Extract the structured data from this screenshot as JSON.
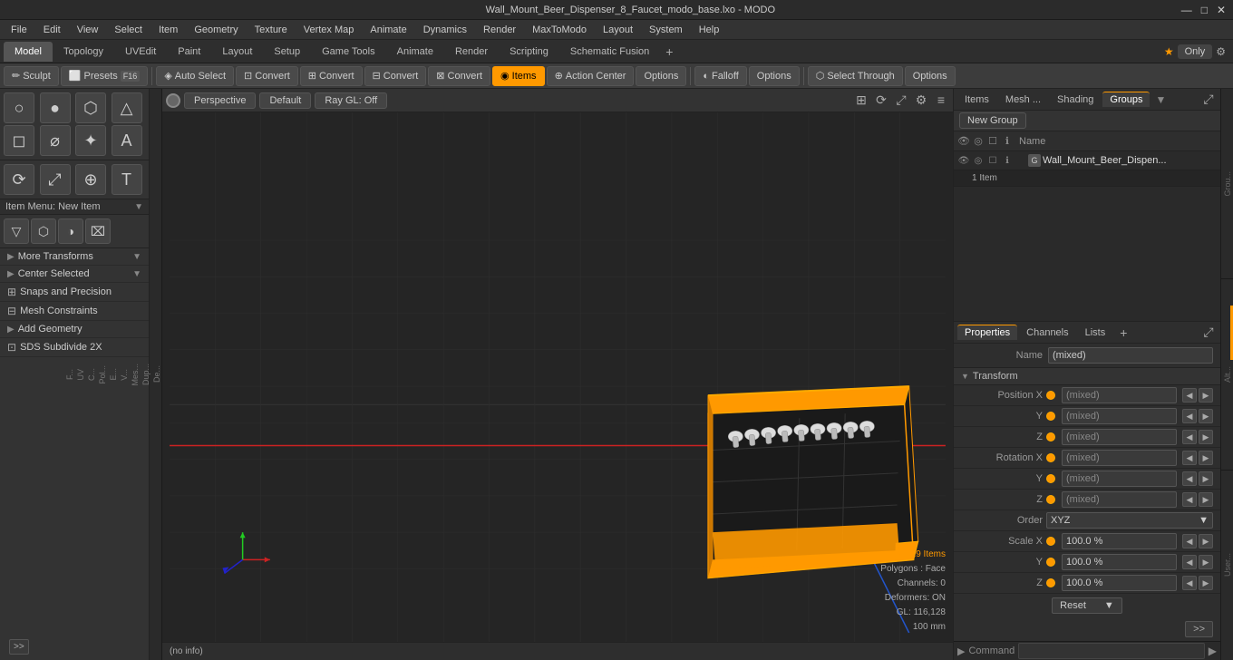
{
  "titleBar": {
    "title": "Wall_Mount_Beer_Dispenser_8_Faucet_modo_base.lxo - MODO",
    "minimize": "—",
    "maximize": "□",
    "close": "✕"
  },
  "menuBar": {
    "items": [
      "File",
      "Edit",
      "View",
      "Select",
      "Item",
      "Geometry",
      "Texture",
      "Vertex Map",
      "Animate",
      "Dynamics",
      "Render",
      "MaxToModo",
      "Layout",
      "System",
      "Help"
    ]
  },
  "tabBar": {
    "tabs": [
      "Model",
      "Topology",
      "UVEdit",
      "Paint",
      "Layout",
      "Setup",
      "Game Tools",
      "Animate",
      "Render",
      "Scripting",
      "Schematic Fusion"
    ],
    "activeTab": "Model",
    "rightLabel": "Only",
    "addLabel": "+"
  },
  "toolbar": {
    "sculpt": "✏ Sculpt",
    "presets": "Presets",
    "presets_key": "F16",
    "autoSelect": "Auto Select",
    "convert1": "Convert",
    "convert2": "Convert",
    "convert3": "Convert",
    "convert4": "Convert",
    "items": "Items",
    "actionCenter": "Action Center",
    "options1": "Options",
    "falloff": "Falloff",
    "options2": "Options",
    "selectThrough": "Select Through",
    "options3": "Options"
  },
  "viewport": {
    "perspective": "Perspective",
    "default": "Default",
    "rayGl": "Ray GL: Off"
  },
  "leftPanel": {
    "tools": [
      "○",
      "●",
      "⬡",
      "△",
      "◻",
      "⌀",
      "✦",
      "A"
    ],
    "tools2": [
      "⟳",
      "⤢",
      "⊕",
      "T"
    ],
    "sectionLabel": "Item Menu: New Item",
    "items": [
      "▽",
      "⬡",
      "◑",
      "⌧"
    ],
    "transforms": "More Transforms",
    "centerSelected": "Center Selected",
    "snaps": "Snaps and Precision",
    "snapsLabel": "Snaps Precision",
    "meshConstraints": "Mesh Constraints",
    "addGeometry": "Add Geometry",
    "sdsSubdivide": "SDS Subdivide 2X",
    "expandBtn": ">>"
  },
  "sideStrip": {
    "labels": [
      "De...",
      "Dup...",
      "Mes...",
      "V...",
      "E...",
      "Pol...",
      "C...",
      "UV",
      "F..."
    ]
  },
  "viewportInfo": {
    "items": "19 Items",
    "polygons": "Polygons : Face",
    "channels": "Channels: 0",
    "deformers": "Deformers: ON",
    "gl": "GL: 116,128",
    "measurement": "100 mm"
  },
  "statusBar": {
    "info": "(no info)"
  },
  "rightPanels": {
    "topTabs": [
      "Items",
      "Mesh ...",
      "Shading",
      "Groups"
    ],
    "activeTopTab": "Groups",
    "newGroup": "New Group",
    "columns": {
      "icons": [
        "👁",
        "🔒",
        "☐",
        "ℹ"
      ],
      "name": "Name"
    },
    "groupItem": {
      "name": "Wall_Mount_Beer_Dispen...",
      "count": "1 Item",
      "icons": [
        "👁",
        "🔒",
        "☐",
        "ℹ"
      ]
    }
  },
  "properties": {
    "tabs": [
      "Properties",
      "Channels",
      "Lists",
      "+"
    ],
    "activeTab": "Properties",
    "name": "(mixed)",
    "sections": {
      "transform": "Transform"
    },
    "fields": {
      "positionX": "(mixed)",
      "positionY": "(mixed)",
      "positionZ": "(mixed)",
      "rotationX": "(mixed)",
      "rotationY": "(mixed)",
      "rotationZ": "(mixed)",
      "order": "XYZ",
      "scaleX": "100.0 %",
      "scaleY": "100.0 %",
      "scaleZ": "100.0 %",
      "reset": "Reset"
    }
  },
  "cmdBar": {
    "label": "▶ Command",
    "placeholder": ""
  },
  "sideLabels": {
    "right": [
      "Grou...",
      "Alt...",
      "User..."
    ]
  }
}
